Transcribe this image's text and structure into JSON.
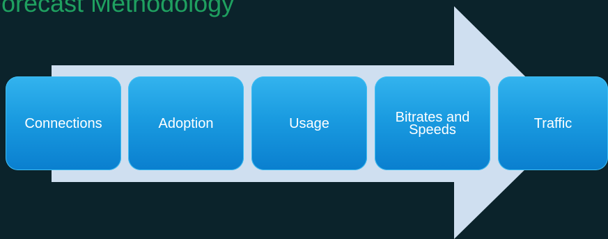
{
  "page_title": "Forecast Methodology",
  "steps": [
    {
      "label": "Connections"
    },
    {
      "label": "Adoption"
    },
    {
      "label": "Usage"
    },
    {
      "label": "Bitrates and Speeds"
    },
    {
      "label": "Traffic"
    }
  ],
  "colors": {
    "background": "#0b232b",
    "title": "#1fa060",
    "arrow": "#cfdff0",
    "box": "#1a9be0",
    "box_text": "#ffffff"
  }
}
